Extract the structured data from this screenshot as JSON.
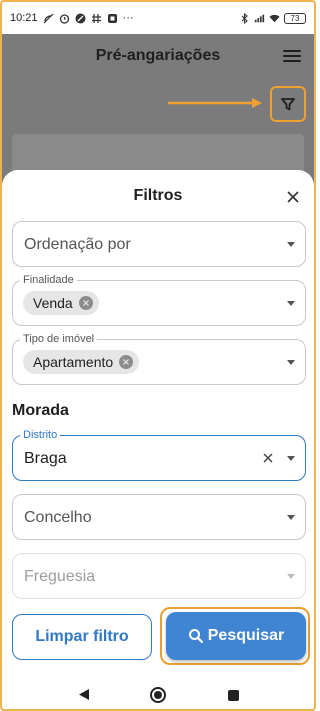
{
  "status_bar": {
    "time": "10:21",
    "battery": "73",
    "more_indicator": "···",
    "icons": [
      "call-off-icon",
      "alarm-icon",
      "do-not-disturb-icon",
      "hash-icon",
      "nfc-icon",
      "bluetooth-icon",
      "signal-icon",
      "wifi-icon",
      "battery-icon"
    ]
  },
  "app_bar": {
    "title": "Pré-angariações",
    "menu_icon": "hamburger-menu-icon",
    "filter_icon": "filter-funnel-icon"
  },
  "annotation": {
    "arrow_color": "#f0a030",
    "highlight_color": "#e8a032"
  },
  "sheet": {
    "title": "Filtros",
    "close_icon": "close-icon",
    "ordenacao": {
      "placeholder": "Ordenação por"
    },
    "finalidade": {
      "label": "Finalidade",
      "chip": "Venda"
    },
    "tipo_imovel": {
      "label": "Tipo de imóvel",
      "chip": "Apartamento"
    },
    "morada_heading": "Morada",
    "distrito": {
      "label": "Distrito",
      "value": "Braga"
    },
    "concelho": {
      "placeholder": "Concelho"
    },
    "freguesia": {
      "placeholder": "Freguesia",
      "disabled": true
    },
    "buttons": {
      "clear": "Limpar filtro",
      "search": "Pesquisar",
      "search_icon": "search-icon"
    }
  },
  "colors": {
    "accent": "#2f79c6",
    "primary_button": "#3f85d1",
    "overlay": "#7b7b7b"
  },
  "nav_bar": {
    "icons": [
      "back-icon",
      "home-icon",
      "recents-icon"
    ]
  }
}
